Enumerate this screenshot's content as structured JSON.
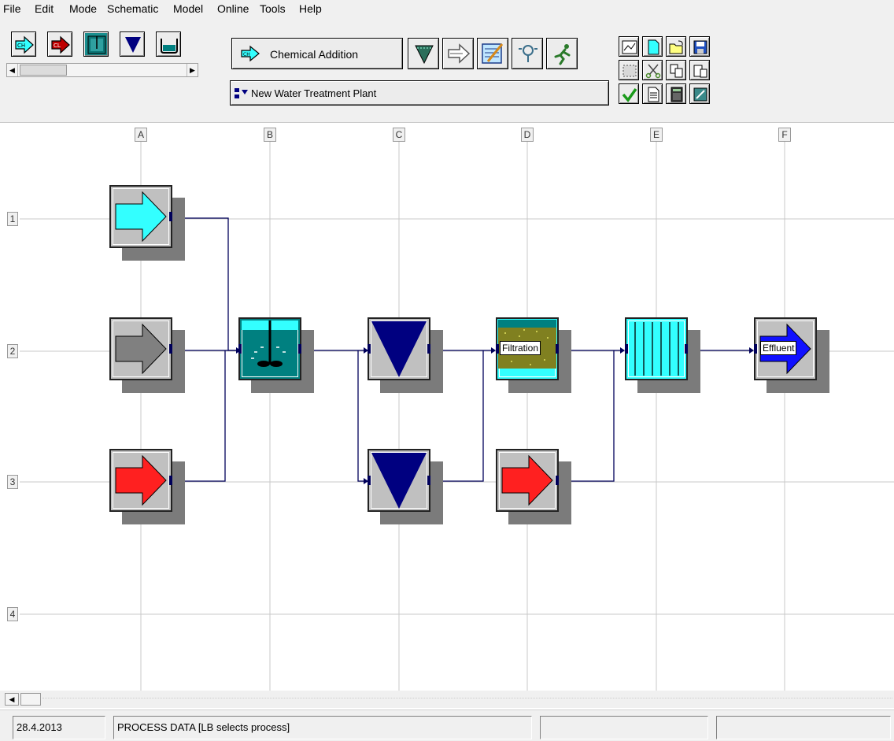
{
  "menu": [
    "File",
    "Edit",
    "Mode",
    "Schematic",
    "Model",
    "Online",
    "Tools",
    "Help"
  ],
  "toolbar": {
    "process_selector_label": "Chemical Addition",
    "plant_selector_label": "New Water Treatment Plant"
  },
  "grid": {
    "columns": [
      "A",
      "B",
      "C",
      "D",
      "E",
      "F"
    ],
    "rows": [
      "1",
      "2",
      "3",
      "4"
    ]
  },
  "units": {
    "filtration_label": "Filtration",
    "effluent_label": "Effluent"
  },
  "status": {
    "date": "28.4.2013",
    "message": "PROCESS DATA [LB selects process]",
    "cell3": "",
    "cell4": ""
  },
  "colors": {
    "influent_cyan": "#33ffff",
    "influent_gray": "#808080",
    "chemical_red": "#ff2020",
    "settler_navy": "#000080",
    "mixer_teal": "#008080",
    "membrane_cyan": "#33ffff",
    "effluent_blue": "#1010ff",
    "pipe_navy": "#00005a"
  },
  "icons": {
    "palette": [
      "influent-ch-icon",
      "chemical-cl-icon",
      "reactor-icon",
      "settler-icon",
      "basin-icon"
    ],
    "process_tools": [
      "settler-tool-icon",
      "pipe-tool-icon",
      "edit-schematic-icon",
      "lamp-tool-icon",
      "runner-tool-icon"
    ],
    "file_tools": [
      "select-area-icon",
      "new-doc-icon",
      "open-folder-icon",
      "save-disk-icon",
      "marquee-icon",
      "cut-icon",
      "copy-icon",
      "paste-icon",
      "check-icon",
      "report-icon",
      "calculator-icon",
      "edit-sheet-icon"
    ]
  }
}
